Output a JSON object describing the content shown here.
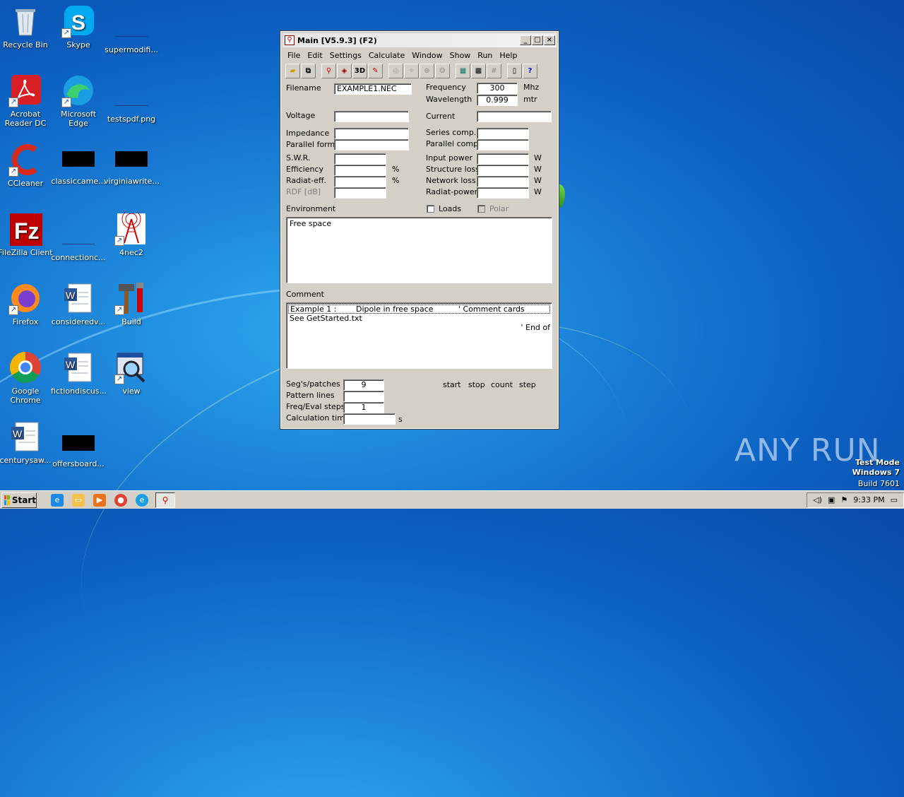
{
  "desktop": {
    "icons": [
      {
        "label": "Recycle Bin"
      },
      {
        "label": "Skype"
      },
      {
        "label": "supermodifi..."
      },
      {
        "label": "Acrobat Reader DC"
      },
      {
        "label": "Microsoft Edge"
      },
      {
        "label": "testspdf.png"
      },
      {
        "label": "CCleaner"
      },
      {
        "label": "classiccame..."
      },
      {
        "label": "virginiawrite..."
      },
      {
        "label": "FileZilla Client"
      },
      {
        "label": "connectionc..."
      },
      {
        "label": "4nec2"
      },
      {
        "label": "Firefox"
      },
      {
        "label": "consideredv..."
      },
      {
        "label": "Build"
      },
      {
        "label": "Google Chrome"
      },
      {
        "label": "fictiondiscus..."
      },
      {
        "label": "view"
      },
      {
        "label": "centurysaw..."
      },
      {
        "label": "offersboard..."
      }
    ]
  },
  "window": {
    "title": "Main [V5.9.3]  (F2)",
    "menu": [
      "File",
      "Edit",
      "Settings",
      "Calculate",
      "Window",
      "Show",
      "Run",
      "Help"
    ],
    "toolbar_3d": "3D",
    "labels": {
      "filename": "Filename",
      "frequency": "Frequency",
      "wavelength": "Wavelength",
      "mhz": "Mhz",
      "mtr": "mtr",
      "voltage": "Voltage",
      "current": "Current",
      "impedance": "Impedance",
      "parallel_form": "Parallel form",
      "series_comp": "Series comp.",
      "parallel_comp": "Parallel comp.",
      "swr": "S.W.R.",
      "efficiency": "Efficiency",
      "radiat_eff": "Radiat-eff.",
      "rdf": "RDF [dB]",
      "pct1": "%",
      "pct2": "%",
      "input_power": "Input power",
      "structure_loss": "Structure loss",
      "network_loss": "Network loss",
      "radiat_power": "Radiat-power",
      "w": "W",
      "environment": "Environment",
      "loads": "Loads",
      "polar": "Polar",
      "comment": "Comment",
      "segs": "Seg's/patches",
      "pattern_lines": "Pattern lines",
      "freq_eval": "Freq/Eval steps",
      "calc_time": "Calculation time",
      "s": "s",
      "start": "start",
      "stop": "stop",
      "count": "count",
      "step": "step"
    },
    "values": {
      "filename": "EXAMPLE1.NEC",
      "frequency": "300",
      "wavelength": "0.999",
      "environment": "Free space",
      "comment_line1_a": "Example 1 :",
      "comment_line1_b": "Dipole in free space",
      "comment_line1_c": "' Comment cards",
      "comment_line2": "See GetStarted.txt",
      "comment_line3": "' End of",
      "segs": "9",
      "freq_eval": "1"
    }
  },
  "taskbar": {
    "start": "Start",
    "clock": "9:33 PM"
  },
  "watermark": {
    "brand": "ANY RUN",
    "line1": "Test Mode",
    "line2": "Windows 7",
    "line3": "Build 7601"
  }
}
